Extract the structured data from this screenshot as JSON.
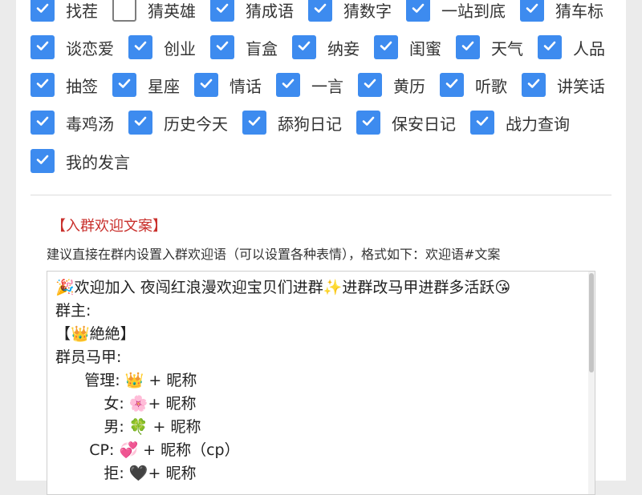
{
  "features": [
    [
      {
        "label": "找茬",
        "checked": true
      },
      {
        "label": "猜英雄",
        "checked": false
      },
      {
        "label": "猜成语",
        "checked": true
      },
      {
        "label": "猜数字",
        "checked": true
      },
      {
        "label": "一站到底",
        "checked": true
      },
      {
        "label": "猜车标",
        "checked": true
      }
    ],
    [
      {
        "label": "谈恋爱",
        "checked": true
      },
      {
        "label": "创业",
        "checked": true
      },
      {
        "label": "盲盒",
        "checked": true
      },
      {
        "label": "纳妾",
        "checked": true
      },
      {
        "label": "闺蜜",
        "checked": true
      },
      {
        "label": "天气",
        "checked": true
      },
      {
        "label": "人品",
        "checked": true
      }
    ],
    [
      {
        "label": "抽签",
        "checked": true
      },
      {
        "label": "星座",
        "checked": true
      },
      {
        "label": "情话",
        "checked": true
      },
      {
        "label": "一言",
        "checked": true
      },
      {
        "label": "黄历",
        "checked": true
      },
      {
        "label": "听歌",
        "checked": true
      },
      {
        "label": "讲笑话",
        "checked": true
      }
    ],
    [
      {
        "label": "毒鸡汤",
        "checked": true
      },
      {
        "label": "历史今天",
        "checked": true
      },
      {
        "label": "舔狗日记",
        "checked": true
      },
      {
        "label": "保安日记",
        "checked": true
      },
      {
        "label": "战力查询",
        "checked": true
      }
    ],
    [
      {
        "label": "我的发言",
        "checked": true
      }
    ]
  ],
  "welcome": {
    "title": "【入群欢迎文案】",
    "hint": "建议直接在群内设置入群欢迎语（可以设置各种表情），格式如下：欢迎语#文案",
    "lines": [
      "🎉欢迎加入 夜闯红浪漫欢迎宝贝们进群✨进群改马甲进群多活跃😘",
      "群主:",
      "【👑絶絶】",
      "群员马甲:",
      "      管理: 👑 + 昵称",
      "          女: 🌸+ 昵称",
      "          男: 🍀 + 昵称",
      "       CP: 💞 + 昵称（cp）",
      "          拒: 🖤+ 昵称"
    ]
  },
  "colors": {
    "accent": "#3d8bef",
    "title_red": "#c9302c"
  }
}
